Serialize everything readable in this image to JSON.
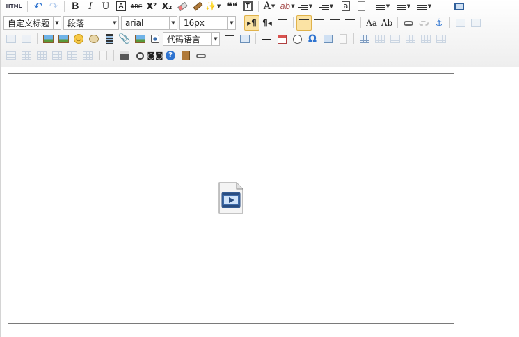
{
  "toolbar": {
    "row1": {
      "html_label": "HTML",
      "bold": "B",
      "italic": "I",
      "underline": "U",
      "font_border": "A",
      "strikethrough": "ABC",
      "superscript": "X²",
      "subscript": "X₂",
      "quote": "❝❝",
      "forecolor": "A",
      "backcolor": "ab",
      "word_image": "a"
    },
    "row2": {
      "custom_title": "自定义标题",
      "paragraph": "段落",
      "font_family": "arial",
      "font_size": "16px",
      "omega": "Ω"
    },
    "row3": {
      "code_language": "代码语言"
    },
    "row4": {
      "help": "?"
    }
  },
  "colors": {
    "toolbar_bg": "#eeeeee",
    "selected_bg": "#fbe3a4",
    "accent_blue": "#2f74d0"
  },
  "editor": {
    "content_placeholder": "video-placeholder-icon"
  }
}
